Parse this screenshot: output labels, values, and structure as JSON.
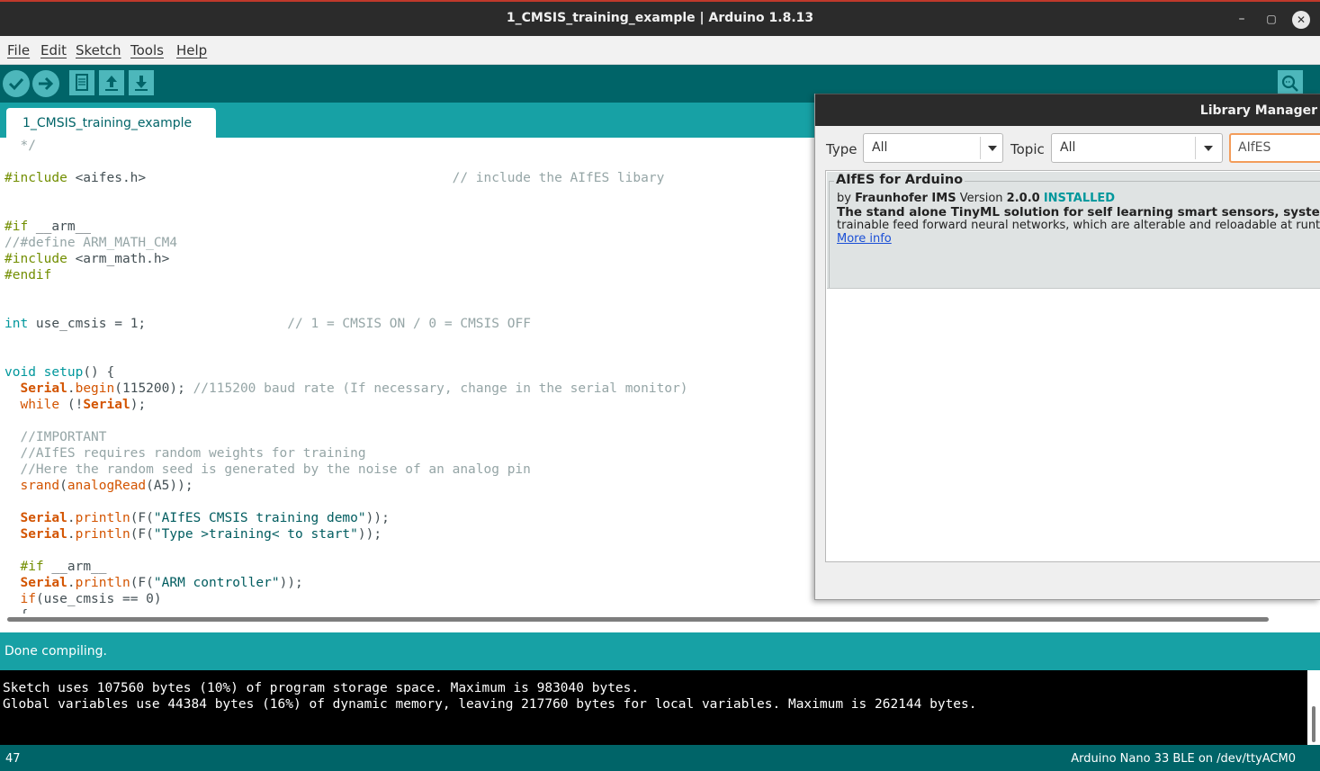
{
  "window": {
    "title": "1_CMSIS_training_example | Arduino 1.8.13",
    "minimize": "–",
    "maximize": "▢",
    "close": "✕"
  },
  "menu": [
    "File",
    "Edit",
    "Sketch",
    "Tools",
    "Help"
  ],
  "toolbar": {
    "buttons": [
      "verify-icon",
      "upload-icon",
      "new-icon",
      "open-icon",
      "save-icon",
      "serial-monitor-icon"
    ]
  },
  "tab": {
    "label": "1_CMSIS_training_example"
  },
  "editor": {
    "lines": [
      "  */",
      "",
      "#include <aifes.h>                                       // include the AIfES libary",
      "",
      "",
      "#if __arm__",
      "//#define ARM_MATH_CM4",
      "#include <arm_math.h>",
      "#endif",
      "",
      "",
      "int use_cmsis = 1;                  // 1 = CMSIS ON / 0 = CMSIS OFF",
      "",
      "",
      "void setup() {",
      "  Serial.begin(115200); //115200 baud rate (If necessary, change in the serial monitor)",
      "  while (!Serial);",
      "",
      "  //IMPORTANT",
      "  //AIfES requires random weights for training",
      "  //Here the random seed is generated by the noise of an analog pin",
      "  srand(analogRead(A5));",
      "",
      "  Serial.println(F(\"AIfES CMSIS training demo\"));",
      "  Serial.println(F(\"Type >training< to start\"));",
      "",
      "  #if __arm__",
      "  Serial.println(F(\"ARM controller\"));",
      "  if(use_cmsis == 0)",
      "  {"
    ]
  },
  "status": {
    "message": "Done compiling."
  },
  "console": {
    "lines": [
      "Sketch uses 107560 bytes (10%) of program storage space. Maximum is 983040 bytes.",
      "Global variables use 44384 bytes (16%) of dynamic memory, leaving 217760 bytes for local variables. Maximum is 262144 bytes."
    ]
  },
  "footer": {
    "line_number": "47",
    "board": "Arduino Nano 33 BLE on /dev/ttyACM0"
  },
  "library_manager": {
    "title": "Library Manager",
    "type_label": "Type",
    "type_value": "All",
    "topic_label": "Topic",
    "topic_value": "All",
    "search_value": "AIfES",
    "entry": {
      "name": "AIfES for Arduino",
      "by": "by",
      "author": "Fraunhofer IMS",
      "version_label": "Version",
      "version": "2.0.0",
      "status": "INSTALLED",
      "summary": "The stand alone TinyML solution for self learning smart sensors, systems and",
      "description": "trainable feed forward neural networks, which are alterable and reloadable at runtime",
      "more_info": "More info"
    }
  },
  "colors": {
    "toolbar": "#006468",
    "tabstrip": "#17a1a5",
    "button": "#4db7bb",
    "installed": "#00979c"
  }
}
